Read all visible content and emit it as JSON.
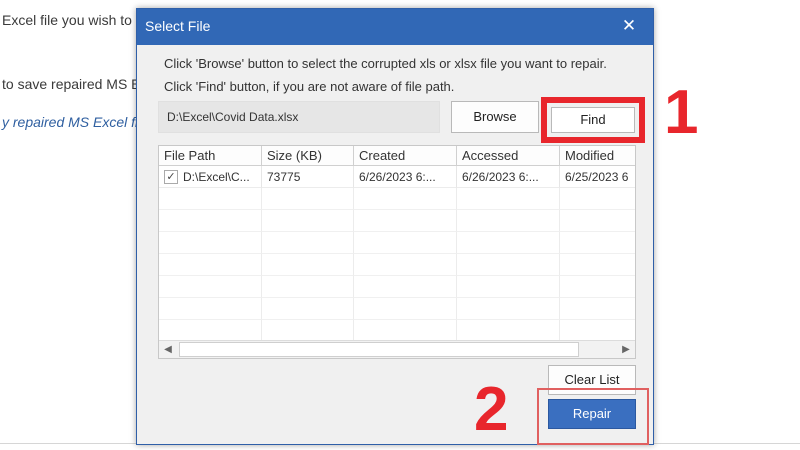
{
  "background": {
    "line1": "Excel file you wish to",
    "line2": "to save repaired MS E",
    "line3": "y repaired MS Excel file"
  },
  "dialog": {
    "title": "Select File",
    "close_glyph": "✕",
    "instruction1": "Click 'Browse' button to select the corrupted xls or xlsx file you want to repair.",
    "instruction2": "Click 'Find' button, if you are not aware of file path.",
    "path_value": "D:\\Excel\\Covid Data.xlsx",
    "browse_label": "Browse",
    "find_label": "Find",
    "clear_list_label": "Clear List",
    "repair_label": "Repair"
  },
  "grid": {
    "columns": [
      "File Path",
      "Size (KB)",
      "Created",
      "Accessed",
      "Modified"
    ],
    "rows": [
      {
        "checked": true,
        "file_path": "D:\\Excel\\C...",
        "size_kb": "73775",
        "created": "6/26/2023 6:...",
        "accessed": "6/26/2023 6:...",
        "modified": "6/25/2023 6"
      }
    ],
    "scroll_left_glyph": "◀",
    "scroll_right_glyph": "▶"
  },
  "annotations": {
    "step1": "1",
    "step2": "2"
  },
  "colors": {
    "title_bar": "#3168b6",
    "annotation_red": "#e8262c",
    "repair_button": "#3a6fc0"
  }
}
